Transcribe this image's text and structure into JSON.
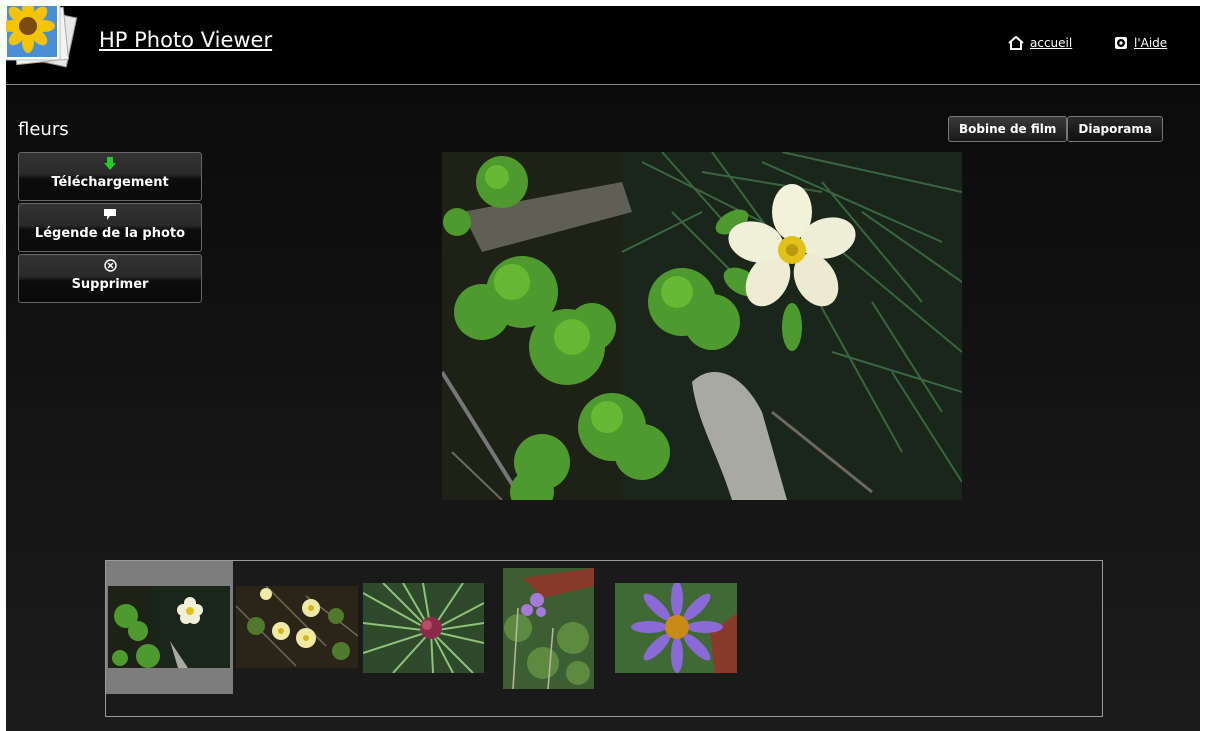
{
  "header": {
    "app_title": "HP Photo Viewer",
    "home_link": "accueil",
    "help_link": "l'Aide",
    "logo_icon": "photo-stack-sunflower-icon"
  },
  "album": {
    "title": "fleurs"
  },
  "view_toggle": {
    "filmstrip_label": "Bobine de film",
    "slideshow_label": "Diaporama",
    "active": "Diaporama"
  },
  "actions": [
    {
      "label": "Téléchargement",
      "icon": "download-arrow-icon",
      "icon_color": "#22cc22"
    },
    {
      "label": "Légende de la photo",
      "icon": "speech-bubble-icon",
      "icon_color": "#ffffff"
    },
    {
      "label": "Supprimer",
      "icon": "circle-x-icon",
      "icon_color": "#ffffff"
    }
  ],
  "filmstrip": {
    "selected_index": 0,
    "thumbnails": [
      {
        "subject": "white-flower-green-leaves"
      },
      {
        "subject": "yellow-white-flowers"
      },
      {
        "subject": "pine-needles-pink-bud"
      },
      {
        "subject": "purple-small-flowers"
      },
      {
        "subject": "purple-aster-daisy"
      }
    ]
  },
  "colors": {
    "background": "#111111",
    "header": "#000000",
    "selected_thumb": "#7d7d7d"
  }
}
